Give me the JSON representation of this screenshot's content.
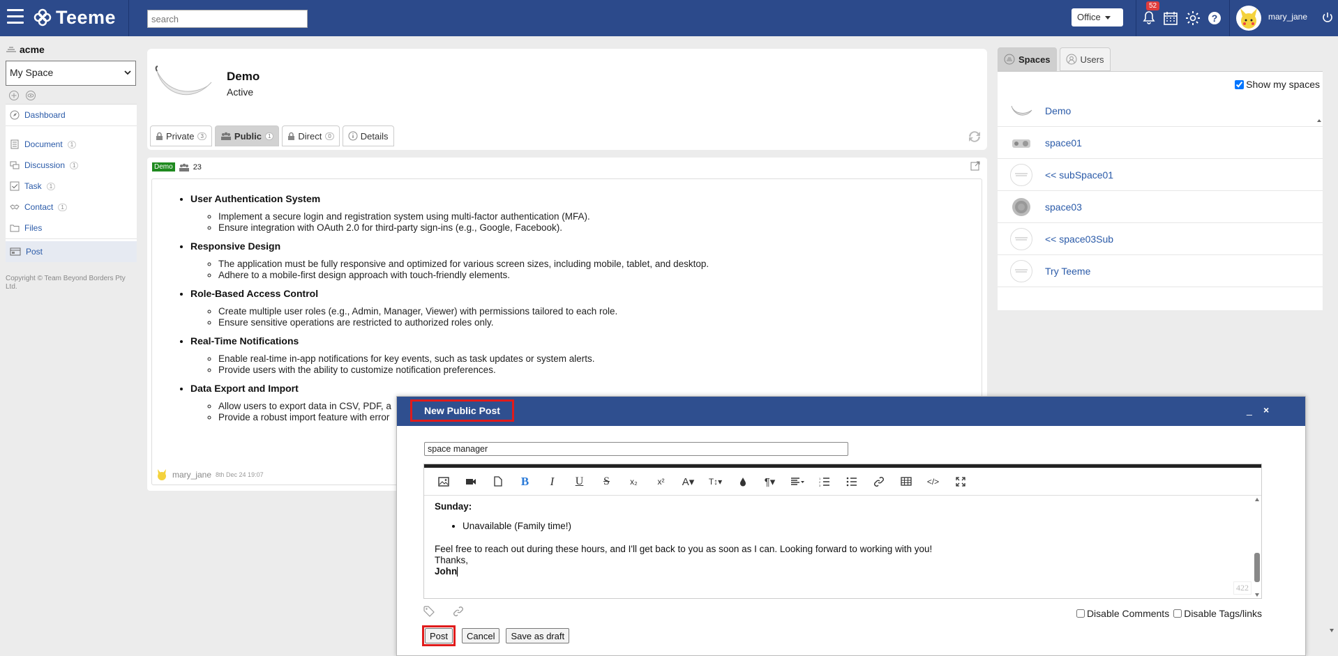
{
  "header": {
    "app_name": "Teeme",
    "search_placeholder": "search",
    "office_label": "Office",
    "notification_count": "52",
    "username": "mary_jane"
  },
  "sidebar": {
    "org_name": "acme",
    "space_select": "My Space",
    "items": [
      {
        "label": "Dashboard",
        "count": ""
      },
      {
        "label": "Document",
        "count": "1"
      },
      {
        "label": "Discussion",
        "count": "1"
      },
      {
        "label": "Task",
        "count": "1"
      },
      {
        "label": "Contact",
        "count": "1"
      },
      {
        "label": "Files",
        "count": ""
      },
      {
        "label": "Post",
        "count": ""
      }
    ],
    "copyright": "Copyright © Team Beyond Borders Pty Ltd."
  },
  "space_header": {
    "title": "Demo",
    "status": "Active",
    "tabs": [
      {
        "label": "Private",
        "count": "3"
      },
      {
        "label": "Public",
        "count": "1"
      },
      {
        "label": "Direct",
        "count": "0"
      },
      {
        "label": "Details",
        "count": ""
      }
    ]
  },
  "post": {
    "tag": "Demo",
    "member_count": "23",
    "sections": [
      {
        "title": "User Authentication System",
        "items": [
          "Implement a secure login and registration system using multi-factor authentication (MFA).",
          "Ensure integration with OAuth 2.0 for third-party sign-ins (e.g., Google, Facebook)."
        ]
      },
      {
        "title": "Responsive Design",
        "items": [
          "The application must be fully responsive and optimized for various screen sizes, including mobile, tablet, and desktop.",
          "Adhere to a mobile-first design approach with touch-friendly elements."
        ]
      },
      {
        "title": "Role-Based Access Control",
        "items": [
          "Create multiple user roles (e.g., Admin, Manager, Viewer) with permissions tailored to each role.",
          "Ensure sensitive operations are restricted to authorized roles only."
        ]
      },
      {
        "title": "Real-Time Notifications",
        "items": [
          "Enable real-time in-app notifications for key events, such as task updates or system alerts.",
          "Provide users with the ability to customize notification preferences."
        ]
      },
      {
        "title": "Data Export and Import",
        "items": [
          "Allow users to export data in CSV, PDF, a",
          "Provide a robust import feature with error"
        ]
      }
    ],
    "author": "mary_jane",
    "date": "8th Dec 24 19:07"
  },
  "right_panel": {
    "tabs": [
      "Spaces",
      "Users"
    ],
    "show_my_spaces": "Show my spaces",
    "spaces": [
      "Demo",
      "space01",
      "<< subSpace01",
      "space03",
      "<< space03Sub",
      "Try Teeme"
    ]
  },
  "modal": {
    "title": "New Public Post",
    "minimize": "_",
    "close": "×",
    "to_value": "space manager",
    "editor": {
      "heading": "Sunday:",
      "bullet": "Unavailable (Family time!)",
      "line1": "Feel free to reach out during these hours, and I'll get back to you as soon as I can. Looking forward to working with you!",
      "line2": "Thanks,",
      "line3": "John",
      "char_count": "422"
    },
    "disable_comments": "Disable Comments",
    "disable_tags": "Disable Tags/links",
    "buttons": {
      "post": "Post",
      "cancel": "Cancel",
      "draft": "Save as draft"
    }
  },
  "colors": {
    "header_bg": "#2c4a8b",
    "modal_header": "#2f4f8f",
    "highlight": "#e01b1b",
    "link": "#2a5aa8",
    "tag_green": "#1f8a1f"
  }
}
